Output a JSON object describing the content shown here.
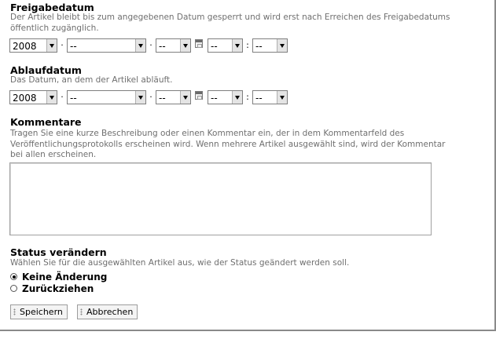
{
  "release": {
    "heading": "Freigabedatum",
    "help": "Der Artikel bleibt bis zum angegebenen Datum gesperrt und wird erst nach Erreichen des Freigabedatums öffentlich zugänglich.",
    "year": "2008",
    "month": "--",
    "day": "--",
    "hour": "--",
    "minute": "--",
    "date_sep": "·",
    "time_sep": ":"
  },
  "expiry": {
    "heading": "Ablaufdatum",
    "help": "Das Datum, an dem der Artikel abläuft.",
    "year": "2008",
    "month": "--",
    "day": "--",
    "hour": "--",
    "minute": "--",
    "date_sep": "·",
    "time_sep": ":"
  },
  "comments": {
    "heading": "Kommentare",
    "help": "Tragen Sie eine kurze Beschreibung oder einen Kommentar ein, der in dem Kommentarfeld des Veröffentlichungsprotokolls erscheinen wird. Wenn mehrere Artikel ausgewählt sind, wird der Kommentar bei allen erscheinen.",
    "value": ""
  },
  "status": {
    "heading": "Status verändern",
    "help": "Wählen Sie für die ausgewählten Artikel aus, wie der Status geändert werden soll.",
    "options": [
      {
        "label": "Keine Änderung",
        "checked": true
      },
      {
        "label": "Zurückziehen",
        "checked": false
      }
    ]
  },
  "buttons": {
    "save": "Speichern",
    "cancel": "Abbrechen"
  }
}
